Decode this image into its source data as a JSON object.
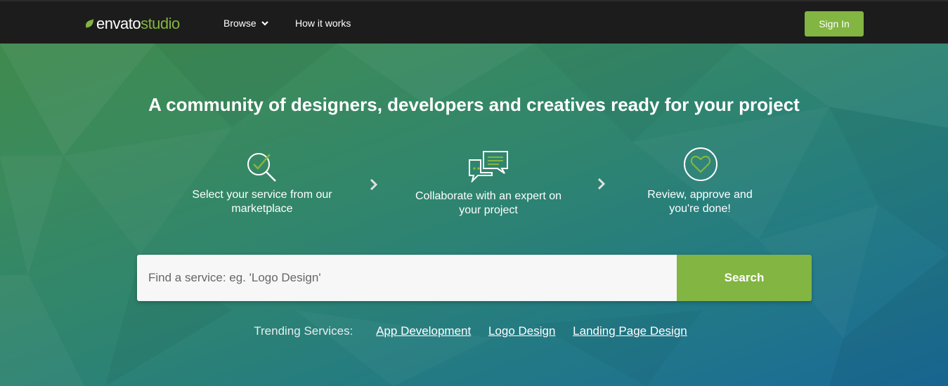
{
  "header": {
    "logo_brand": "envato",
    "logo_product": "studio",
    "nav": {
      "browse_label": "Browse",
      "how_label": "How it works"
    },
    "signin_label": "Sign In"
  },
  "hero": {
    "headline": "A community of designers, developers and creatives ready for your project",
    "steps": [
      {
        "line1": "Select your service from our",
        "line2": "marketplace",
        "icon": "magnifier-check-icon"
      },
      {
        "line1": "Collaborate with an expert on",
        "line2": "your project",
        "icon": "chat-bubbles-icon"
      },
      {
        "line1": "Review, approve and",
        "line2": "you're done!",
        "icon": "heart-circle-icon"
      }
    ]
  },
  "search": {
    "placeholder": "Find a service: eg. 'Logo Design'",
    "button_label": "Search"
  },
  "trending": {
    "label": "Trending Services:",
    "links": [
      "App Development",
      "Logo Design",
      "Landing Page Design"
    ]
  },
  "colors": {
    "accent": "#82b541",
    "topbar": "#1c1c1c"
  }
}
